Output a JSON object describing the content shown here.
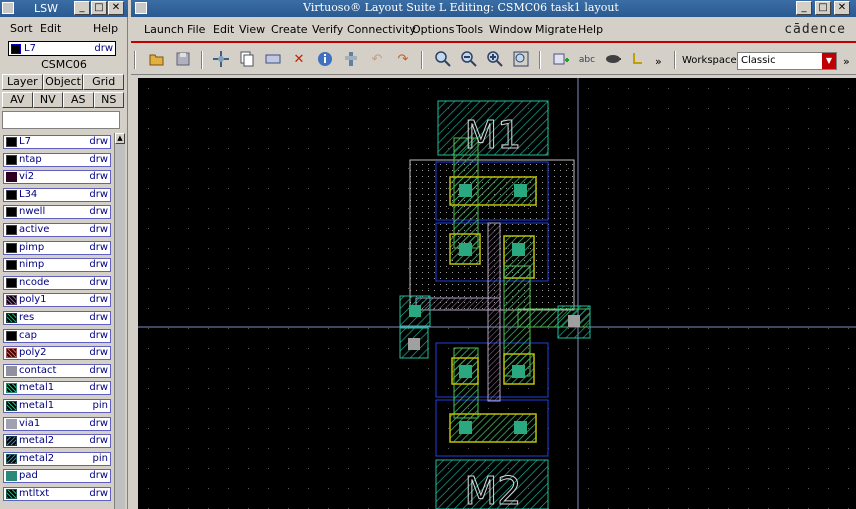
{
  "lsw": {
    "title": "LSW",
    "menu": {
      "sort": "Sort",
      "edit": "Edit",
      "help": "Help"
    },
    "window_buttons": {
      "minimize": "_",
      "maximize": "□",
      "close": "✕"
    },
    "current_layer": {
      "name": "L7",
      "purpose": "drw"
    },
    "techlib": "CSMC06",
    "view_tabs": [
      "Layer",
      "Object",
      "Grid"
    ],
    "visibility_buttons": [
      "AV",
      "NV",
      "AS",
      "NS"
    ],
    "filter_value": "",
    "layers": [
      {
        "name": "L7",
        "purpose": "drw",
        "color": "#000000"
      },
      {
        "name": "ntap",
        "purpose": "drw",
        "color": "#000000"
      },
      {
        "name": "vi2",
        "purpose": "drw",
        "color": "#300020"
      },
      {
        "name": "L34",
        "purpose": "drw",
        "color": "#000000"
      },
      {
        "name": "nwell",
        "purpose": "drw",
        "color": "#000000"
      },
      {
        "name": "active",
        "purpose": "drw",
        "color": "#000000"
      },
      {
        "name": "pimp",
        "purpose": "drw",
        "color": "#000000"
      },
      {
        "name": "nimp",
        "purpose": "drw",
        "color": "#000000"
      },
      {
        "name": "ncode",
        "purpose": "drw",
        "color": "#000000"
      },
      {
        "name": "poly1",
        "purpose": "drw",
        "color": "#6a4a6a"
      },
      {
        "name": "res",
        "purpose": "drw",
        "color": "#1a3a3a"
      },
      {
        "name": "cap",
        "purpose": "drw",
        "color": "#000000"
      },
      {
        "name": "poly2",
        "purpose": "drw",
        "color": "#a05050"
      },
      {
        "name": "contact",
        "purpose": "drw",
        "color": "#9090a0"
      },
      {
        "name": "metal1",
        "purpose": "drw",
        "color": "#2a8a6a"
      },
      {
        "name": "metal1",
        "purpose": "pin",
        "color": "#1a4a4a"
      },
      {
        "name": "via1",
        "purpose": "drw",
        "color": "#a0a0b0"
      },
      {
        "name": "metal2",
        "purpose": "drw",
        "color": "#1a3a4a"
      },
      {
        "name": "metal2",
        "purpose": "pin",
        "color": "#1a5a5a"
      },
      {
        "name": "pad",
        "purpose": "drw",
        "color": "#2a8a7a"
      },
      {
        "name": "mtltxt",
        "purpose": "drw",
        "color": "#1a5a4a"
      }
    ]
  },
  "main": {
    "title": "Virtuoso® Layout Suite L Editing: CSMC06 task1 layout",
    "window_buttons": {
      "minimize": "_",
      "maximize": "□",
      "close": "✕"
    },
    "menus": [
      "Launch",
      "File",
      "Edit",
      "View",
      "Create",
      "Verify",
      "Connectivity",
      "Options",
      "Tools",
      "Window",
      "Migrate",
      "Help"
    ],
    "brand": "cādence",
    "toolbar_overflow": "»",
    "workspace": {
      "label": "Workspace:",
      "value": "Classic"
    }
  },
  "layout": {
    "labels": [
      "M1",
      "M2"
    ]
  }
}
